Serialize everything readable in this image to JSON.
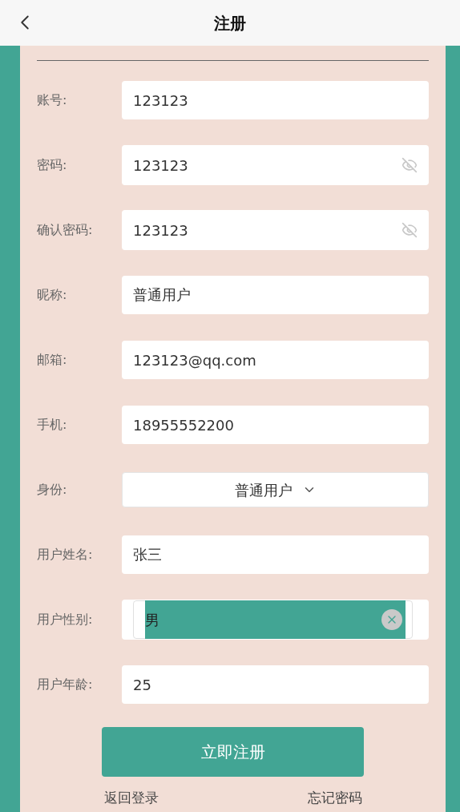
{
  "header": {
    "title": "注册"
  },
  "fields": [
    {
      "kind": "text",
      "label": "账号:",
      "value": "123123"
    },
    {
      "kind": "password",
      "label": "密码:",
      "value": "123123"
    },
    {
      "kind": "password",
      "label": "确认密码:",
      "value": "123123"
    },
    {
      "kind": "text",
      "label": "昵称:",
      "value": "普通用户"
    },
    {
      "kind": "text",
      "label": "邮箱:",
      "value": "123123@qq.com"
    },
    {
      "kind": "text",
      "label": "手机:",
      "value": "18955552200"
    },
    {
      "kind": "select",
      "label": "身份:",
      "value": "普通用户"
    },
    {
      "kind": "text",
      "label": "用户姓名:",
      "value": "张三"
    },
    {
      "kind": "choice",
      "label": "用户性别:",
      "value": "男"
    },
    {
      "kind": "text",
      "label": "用户年龄:",
      "value": "25"
    }
  ],
  "submit": "立即注册",
  "links": [
    "返回登录",
    "忘记密码"
  ]
}
